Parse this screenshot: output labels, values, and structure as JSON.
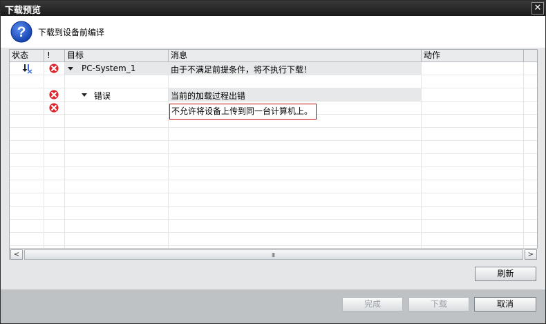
{
  "dialog": {
    "title": "下载预览",
    "close_label": "✕"
  },
  "header": {
    "text": "下载到设备前编译",
    "icon": "question-icon"
  },
  "grid": {
    "columns": [
      {
        "label": "状态"
      },
      {
        "label": "!"
      },
      {
        "label": "目标"
      },
      {
        "label": "消息"
      },
      {
        "label": "动作"
      }
    ],
    "rows": [
      {
        "status_icon": "download-error-icon",
        "severity_icon": "error-icon",
        "target": "PC-System_1",
        "expanded": true,
        "message": "由于不满足前提条件，将不执行下载！",
        "action": ""
      },
      {
        "status_icon": "",
        "severity_icon": "",
        "target": "",
        "message": "",
        "action": ""
      },
      {
        "status_icon": "",
        "severity_icon": "error-icon",
        "target": "错误",
        "expanded": true,
        "message": "当前的加载过程出错",
        "action": ""
      },
      {
        "status_icon": "",
        "severity_icon": "error-icon",
        "target": "",
        "message": "不允许将设备上传到同一台计算机上。",
        "action": ""
      }
    ],
    "scroll_left": "<",
    "scroll_right": ">",
    "scroll_grip": "III"
  },
  "buttons": {
    "refresh": "刷新",
    "finish": "完成",
    "download": "下载",
    "cancel": "取消"
  },
  "colors": {
    "title_bar": "#1f1f1f",
    "error": "#e0242c",
    "accent": "#1a4fc2",
    "highlight_border": "#c00000"
  }
}
